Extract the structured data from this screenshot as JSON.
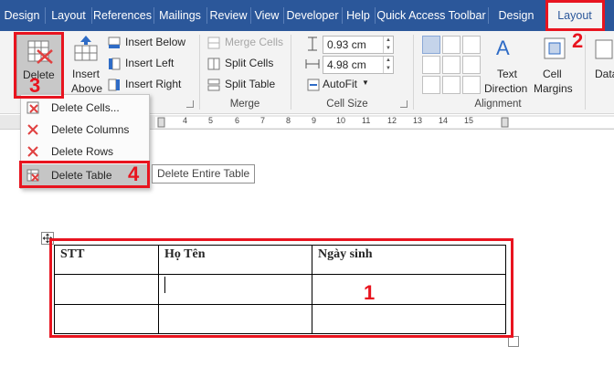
{
  "tabs": [
    "Design",
    "Layout",
    "References",
    "Mailings",
    "Review",
    "View",
    "Developer",
    "Help",
    "Quick Access Toolbar",
    "Design",
    "Layout"
  ],
  "ribbon": {
    "delete_label": "Delete",
    "insert_above_line1": "Insert",
    "insert_above_line2": "Above",
    "insert_below": "Insert Below",
    "insert_left": "Insert Left",
    "insert_right": "Insert Right",
    "merge_cells": "Merge Cells",
    "split_cells": "Split Cells",
    "split_table": "Split Table",
    "merge_group": "Merge",
    "height_value": "0.93 cm",
    "width_value": "4.98 cm",
    "autofit": "AutoFit",
    "cell_size_group": "Cell Size",
    "text_direction_line1": "Text",
    "text_direction_line2": "Direction",
    "cell_margins_line1": "Cell",
    "cell_margins_line2": "Margins",
    "alignment_group": "Alignment",
    "data_label": "Data"
  },
  "ruler_ticks": [
    "4",
    "5",
    "6",
    "7",
    "8",
    "9",
    "10",
    "11",
    "12",
    "13",
    "14",
    "15"
  ],
  "delete_menu": {
    "items": [
      "Delete Cells...",
      "Delete Columns",
      "Delete Rows",
      "Delete Table"
    ],
    "tooltip": "Delete Entire Table"
  },
  "table": {
    "headers": [
      "STT",
      "Họ Tên",
      "Ngày sinh"
    ],
    "rows": [
      [
        "",
        "",
        ""
      ],
      [
        "",
        "",
        ""
      ]
    ]
  },
  "annotations": [
    "1",
    "2",
    "3",
    "4"
  ],
  "colors": {
    "tab_bar": "#2b579a",
    "annotation_red": "#e8141f",
    "ribbon_bg": "#f3f3f3"
  }
}
